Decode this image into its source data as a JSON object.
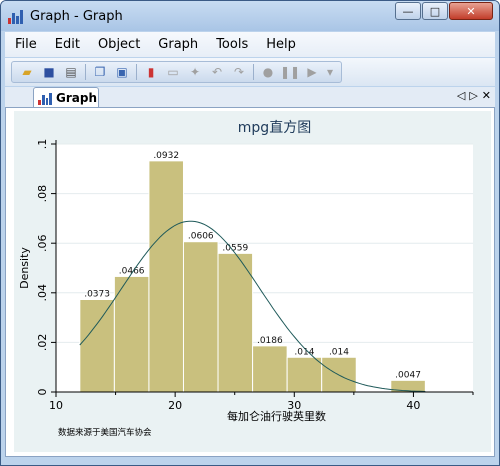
{
  "window": {
    "title": "Graph - Graph",
    "min": "—",
    "max": "□",
    "close": "✕"
  },
  "menu": [
    "File",
    "Edit",
    "Object",
    "Graph",
    "Tools",
    "Help"
  ],
  "toolbar_icons": [
    "open-icon",
    "save-icon",
    "print-icon",
    "copy-icon",
    "paste-icon",
    "graph-editor-icon",
    "properties-icon",
    "pointer-icon",
    "undo-icon",
    "redo-icon",
    "record-icon",
    "pause-icon",
    "play-icon",
    "dropdown-icon"
  ],
  "tab": {
    "label": "Graph",
    "prev": "◁",
    "next": "▷",
    "close": "✕"
  },
  "footnote": "数据来源于美国汽车协会",
  "colors": {
    "bar_fill": "#c9c07e",
    "bar_edge": "#ffffff",
    "curve": "#1f5a5a",
    "plot_bg": "#ffffff",
    "graph_bg": "#eaf2f3",
    "title": "#1e3a5a"
  },
  "chart_data": {
    "type": "bar",
    "title": "mpg直方图",
    "xlabel": "每加仑油行驶英里数",
    "ylabel": "Density",
    "xlim": [
      10,
      45
    ],
    "ylim": [
      0,
      0.1
    ],
    "xticks": [
      10,
      20,
      30,
      40
    ],
    "yticks": [
      0,
      0.02,
      0.04,
      0.06,
      0.08,
      0.1
    ],
    "ytick_labels": [
      "0",
      ".02",
      ".04",
      ".06",
      ".08",
      ".1"
    ],
    "bins": [
      {
        "x0": 12.0,
        "x1": 14.9,
        "value": 0.0373,
        "label": ".0373"
      },
      {
        "x0": 14.9,
        "x1": 17.8,
        "value": 0.0466,
        "label": ".0466"
      },
      {
        "x0": 17.8,
        "x1": 20.7,
        "value": 0.0932,
        "label": ".0932"
      },
      {
        "x0": 20.7,
        "x1": 23.6,
        "value": 0.0606,
        "label": ".0606"
      },
      {
        "x0": 23.6,
        "x1": 26.5,
        "value": 0.0559,
        "label": ".0559"
      },
      {
        "x0": 26.5,
        "x1": 29.4,
        "value": 0.0186,
        "label": ".0186"
      },
      {
        "x0": 29.4,
        "x1": 32.3,
        "value": 0.014,
        "label": ".014"
      },
      {
        "x0": 32.3,
        "x1": 35.2,
        "value": 0.014,
        "label": ".014"
      },
      {
        "x0": 38.1,
        "x1": 41.0,
        "value": 0.0047,
        "label": ".0047"
      }
    ],
    "normal_curve": {
      "mean": 21.3,
      "sd": 5.79
    },
    "grid": true,
    "legend": "none"
  }
}
